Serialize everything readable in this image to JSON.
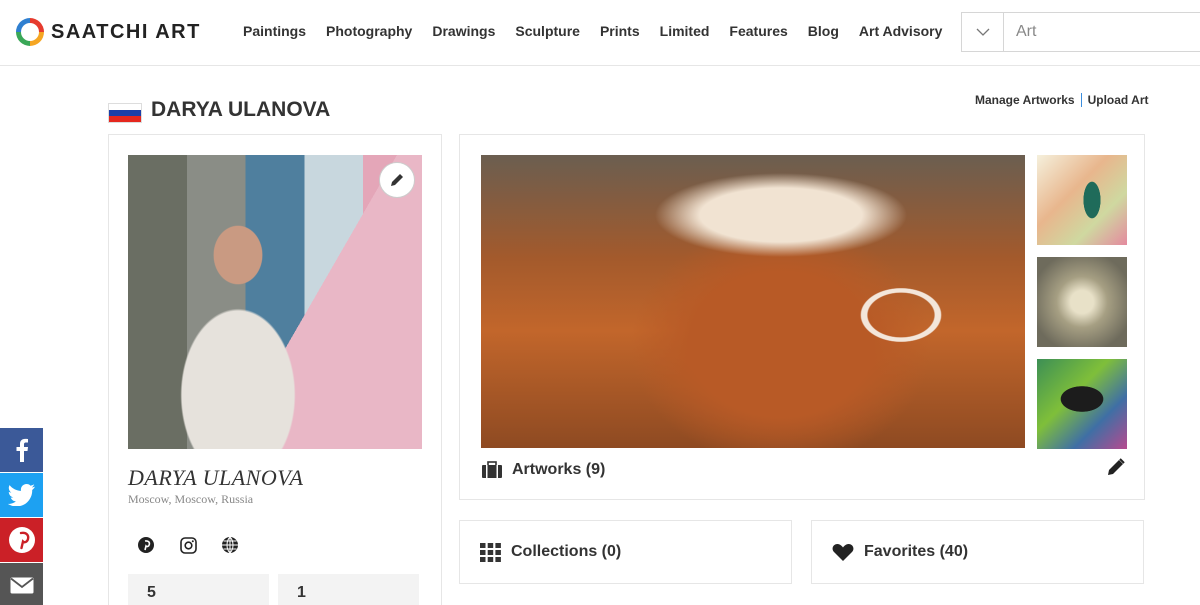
{
  "brand": {
    "name": "SAATCHI ART"
  },
  "nav": [
    "Paintings",
    "Photography",
    "Drawings",
    "Sculpture",
    "Prints",
    "Limited",
    "Features",
    "Blog",
    "Art Advisory"
  ],
  "search": {
    "placeholder": "Art",
    "dropdown_icon": "chevron-down-icon"
  },
  "artist": {
    "name": "DARYA ULANOVA",
    "display_name": "DARYA ULANOVA",
    "location": "Moscow, Moscow, Russia",
    "flag_colors": [
      "#ffffff",
      "#1c3fa8",
      "#e5271e"
    ]
  },
  "manage": {
    "manage_label": "Manage Artworks",
    "upload_label": "Upload Art",
    "separator_color": "#3b8ddd"
  },
  "social": [
    "pinterest-icon",
    "instagram-icon",
    "globe-icon"
  ],
  "stats": [
    {
      "value": "5"
    },
    {
      "value": "1"
    }
  ],
  "sections": {
    "artworks": "Artworks (9)",
    "collections": "Collections (0)",
    "favorites": "Favorites (40)"
  },
  "share": [
    {
      "icon": "facebook-icon",
      "color": "#3b5998"
    },
    {
      "icon": "twitter-icon",
      "color": "#1da1f2"
    },
    {
      "icon": "pinterest-icon",
      "color": "#cb2027"
    },
    {
      "icon": "email-icon",
      "color": "#555555"
    }
  ]
}
